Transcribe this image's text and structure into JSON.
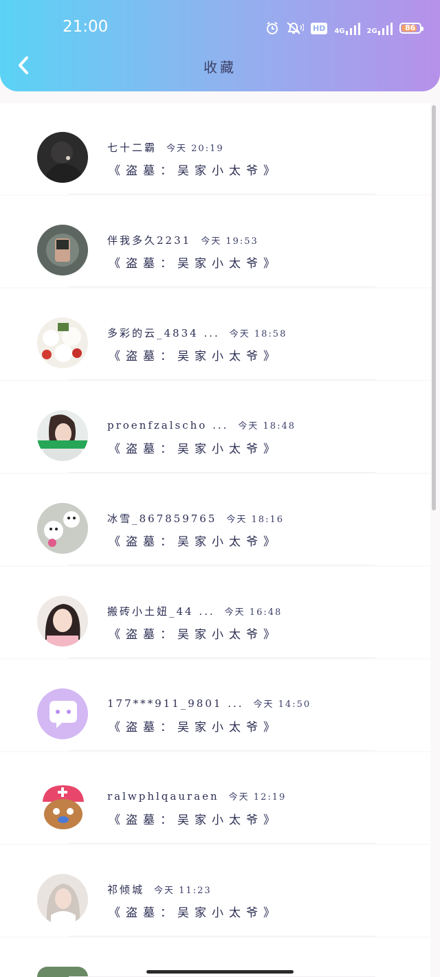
{
  "status_bar": {
    "time": "21:00",
    "hd_label": "HD",
    "net1_label": "4G",
    "net2_label": "2G",
    "battery": "86",
    "battery_level_percent": 86,
    "icons": [
      "alarm-icon",
      "mute-icon",
      "hd-icon",
      "signal-icon",
      "signal-icon",
      "battery-icon"
    ]
  },
  "header": {
    "title": "收藏",
    "back_icon": "chevron-left-icon"
  },
  "colors": {
    "header_gradient_start": "#5ad3f5",
    "header_gradient_end": "#b691ea",
    "text": "#2b2d52"
  },
  "items": [
    {
      "name": "七十二霸",
      "time": "今天 20:19",
      "title": "《盗墓：吴家小太爷》"
    },
    {
      "name": "伴我多久2231",
      "time": "今天 19:53",
      "title": "《盗墓：吴家小太爷》"
    },
    {
      "name": "多彩的云_4834 ...",
      "time": "今天 18:58",
      "title": "《盗墓：吴家小太爷》"
    },
    {
      "name": "proenfzalscho ...",
      "time": "今天 18:48",
      "title": "《盗墓：吴家小太爷》"
    },
    {
      "name": "冰雪_867859765",
      "time": "今天 18:16",
      "title": "《盗墓：吴家小太爷》"
    },
    {
      "name": "搬砖小土妞_44 ...",
      "time": "今天 16:48",
      "title": "《盗墓：吴家小太爷》"
    },
    {
      "name": "177***911_9801 ...",
      "time": "今天 14:50",
      "title": "《盗墓：吴家小太爷》"
    },
    {
      "name": "ralwphlqauraen",
      "time": "今天 12:19",
      "title": "《盗墓：吴家小太爷》"
    },
    {
      "name": "祁倾城",
      "time": "今天 11:23",
      "title": "《盗墓：吴家小太爷》"
    }
  ]
}
